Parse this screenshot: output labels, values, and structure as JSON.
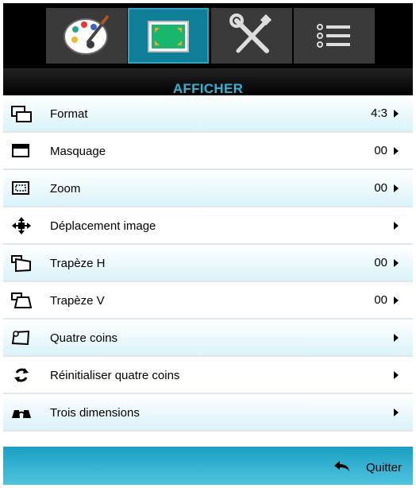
{
  "tabs": [
    {
      "icon": "palette-icon",
      "active": false
    },
    {
      "icon": "display-icon",
      "active": true
    },
    {
      "icon": "tools-icon",
      "active": false
    },
    {
      "icon": "list-icon",
      "active": false
    }
  ],
  "menu_title": "AFFICHER",
  "rows": [
    {
      "icon": "format-icon",
      "label": "Format",
      "value": "4:3"
    },
    {
      "icon": "mask-icon",
      "label": "Masquage",
      "value": "00"
    },
    {
      "icon": "zoom-icon",
      "label": "Zoom",
      "value": "00"
    },
    {
      "icon": "move-icon",
      "label": "Déplacement image",
      "value": ""
    },
    {
      "icon": "keystone-h-icon",
      "label": "Trapèze H",
      "value": "00"
    },
    {
      "icon": "keystone-v-icon",
      "label": "Trapèze V",
      "value": "00"
    },
    {
      "icon": "four-corners-icon",
      "label": "Quatre coins",
      "value": ""
    },
    {
      "icon": "reset-icon",
      "label": "Réinitialiser quatre coins",
      "value": ""
    },
    {
      "icon": "3d-glasses-icon",
      "label": "Trois dimensions",
      "value": ""
    }
  ],
  "footer": {
    "quit_label": "Quitter",
    "quit_icon": "back-arrow-icon"
  },
  "colors": {
    "accent": "#2fb6d4",
    "active_tab": "#0e7f97",
    "footer": "#2aa8c8"
  }
}
